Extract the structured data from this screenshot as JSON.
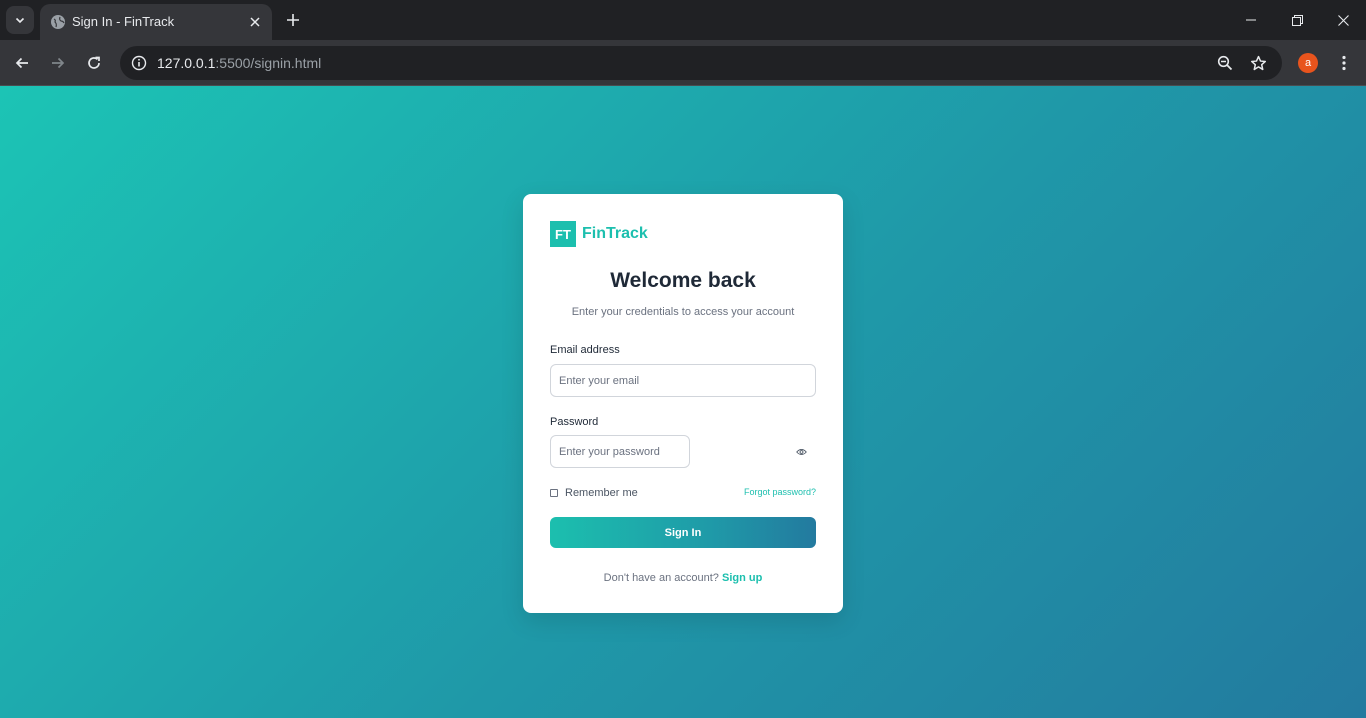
{
  "browser": {
    "tab_title": "Sign In - FinTrack",
    "url_host": "127.0.0.1",
    "url_path": ":5500/signin.html",
    "profile_initial": "a"
  },
  "icons": {
    "tab_search": "chevron-down-icon",
    "favicon": "globe-icon",
    "tab_close": "close-icon",
    "new_tab": "plus-icon",
    "back": "arrow-left-icon",
    "forward": "arrow-right-icon",
    "reload": "reload-icon",
    "site_info": "info-icon",
    "zoom": "zoom-out-icon",
    "bookmark": "star-icon",
    "menu": "kebab-menu-icon",
    "password_toggle": "eye-icon"
  },
  "colors": {
    "accent": "#1cbfae",
    "gradient_start": "#1cc4b5",
    "gradient_end": "#237a9f",
    "avatar": "#e8541d"
  },
  "signin": {
    "logo_mark": "FT",
    "brand_name": "FinTrack",
    "heading": "Welcome back",
    "subheading": "Enter your credentials to access your account",
    "email_label": "Email address",
    "email_placeholder": "Enter your email",
    "email_value": "",
    "password_label": "Password",
    "password_placeholder": "Enter your password",
    "password_value": "",
    "remember_label": "Remember me",
    "remember_checked": false,
    "forgot_label": "Forgot password?",
    "submit_label": "Sign In",
    "signup_prompt": "Don't have an account?",
    "signup_link": "Sign up"
  }
}
